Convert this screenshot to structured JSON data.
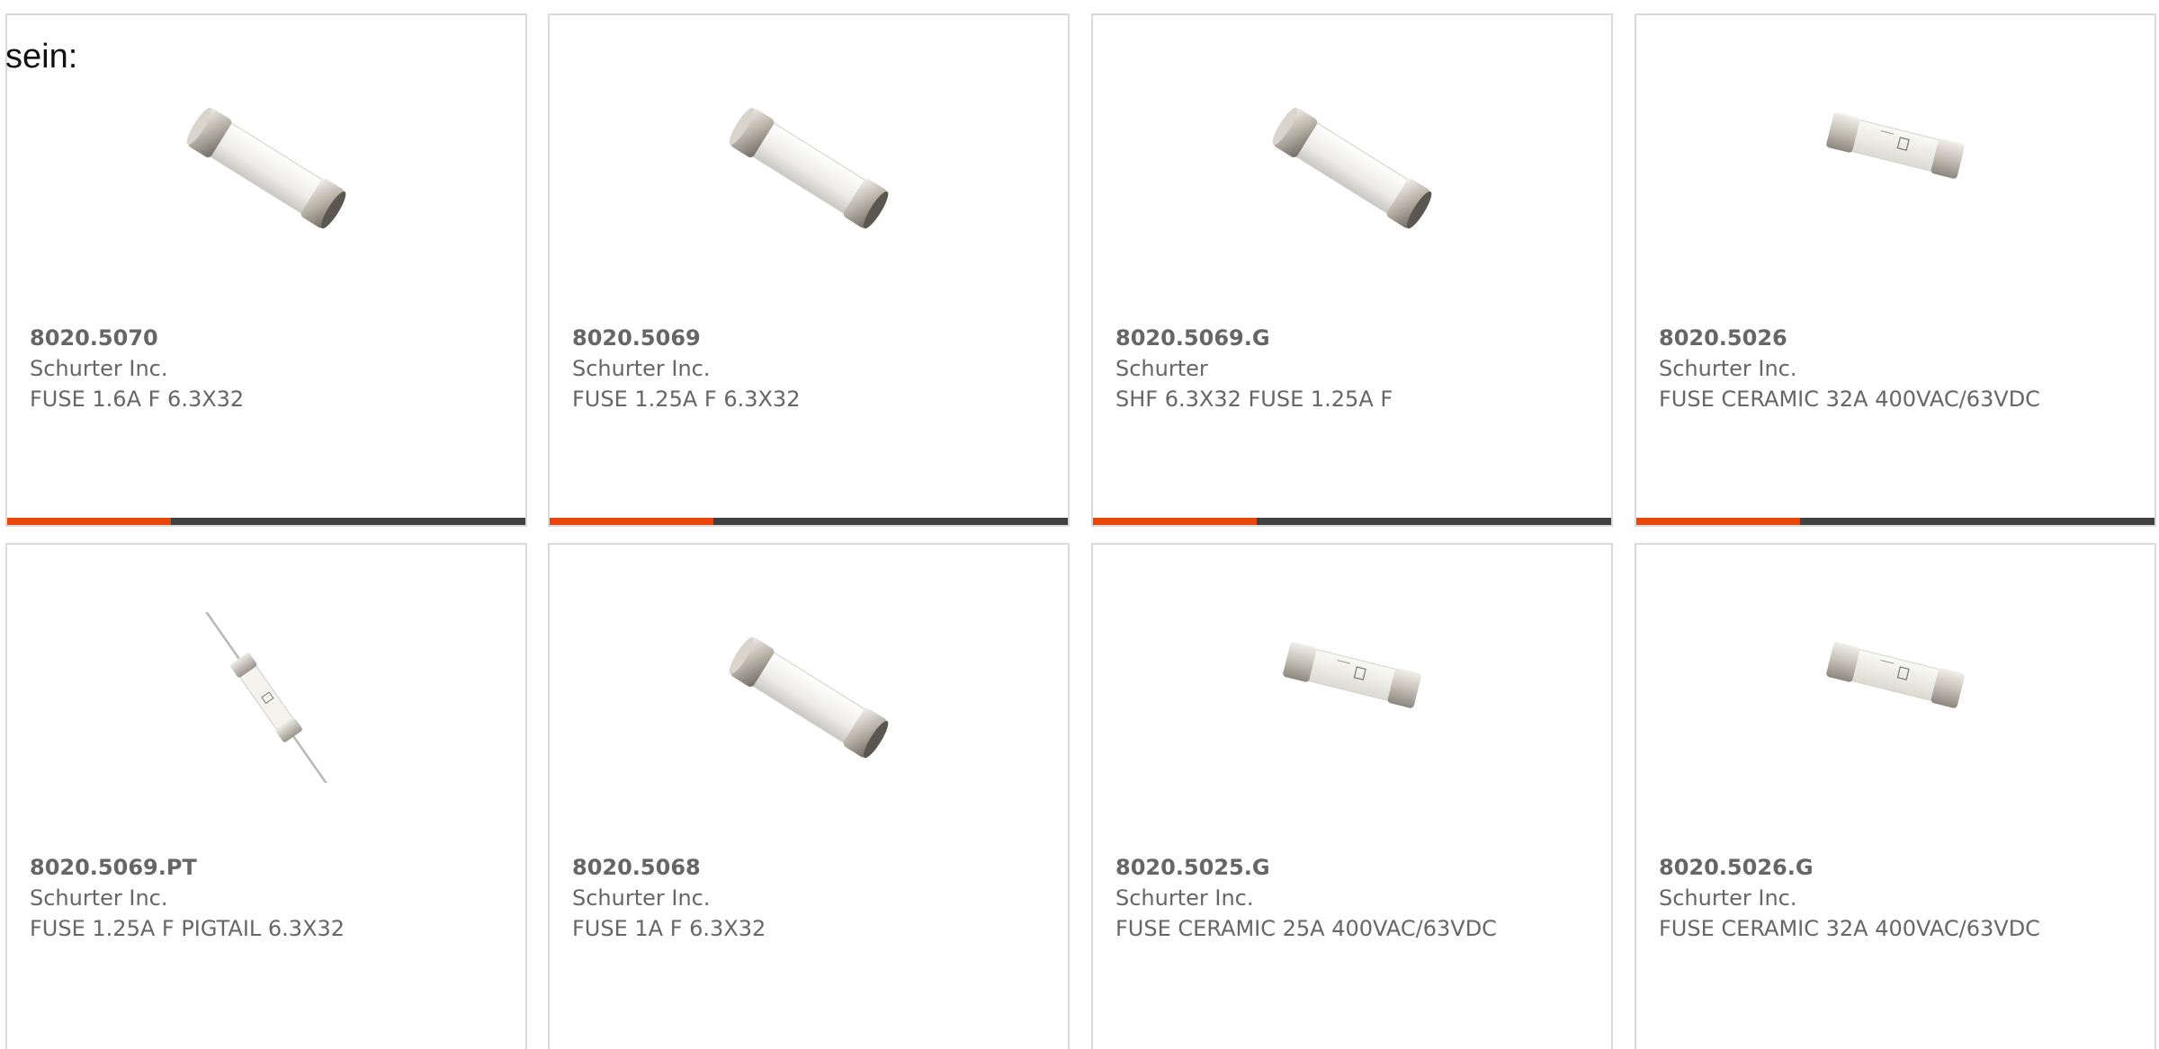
{
  "intro": {
    "text": "sein:"
  },
  "colors": {
    "accent": "#e8450a",
    "bar": "#404040",
    "text": "#666666",
    "border": "#dadada"
  },
  "products": [
    {
      "part_number": "8020.5070",
      "manufacturer": "Schurter Inc.",
      "description": "FUSE 1.6A F 6.3X32",
      "icon": "cartridge-fuse-icon",
      "show_bar": true
    },
    {
      "part_number": "8020.5069",
      "manufacturer": "Schurter Inc.",
      "description": "FUSE 1.25A F 6.3X32",
      "icon": "cartridge-fuse-icon",
      "show_bar": true
    },
    {
      "part_number": "8020.5069.G",
      "manufacturer": "Schurter",
      "description": "SHF 6.3X32 FUSE 1.25A F",
      "icon": "cartridge-fuse-icon",
      "show_bar": true
    },
    {
      "part_number": "8020.5026",
      "manufacturer": "Schurter Inc.",
      "description": "FUSE CERAMIC 32A 400VAC/63VDC",
      "icon": "ceramic-fuse-icon",
      "show_bar": true
    },
    {
      "part_number": "8020.5069.PT",
      "manufacturer": "Schurter Inc.",
      "description": "FUSE 1.25A F PIGTAIL 6.3X32",
      "icon": "pigtail-fuse-icon",
      "show_bar": false
    },
    {
      "part_number": "8020.5068",
      "manufacturer": "Schurter Inc.",
      "description": "FUSE 1A F 6.3X32",
      "icon": "cartridge-fuse-icon",
      "show_bar": false
    },
    {
      "part_number": "8020.5025.G",
      "manufacturer": "Schurter Inc.",
      "description": "FUSE CERAMIC 25A 400VAC/63VDC",
      "icon": "ceramic-fuse-icon",
      "show_bar": false
    },
    {
      "part_number": "8020.5026.G",
      "manufacturer": "Schurter Inc.",
      "description": "FUSE CERAMIC 32A 400VAC/63VDC",
      "icon": "ceramic-fuse-icon",
      "show_bar": false
    }
  ]
}
